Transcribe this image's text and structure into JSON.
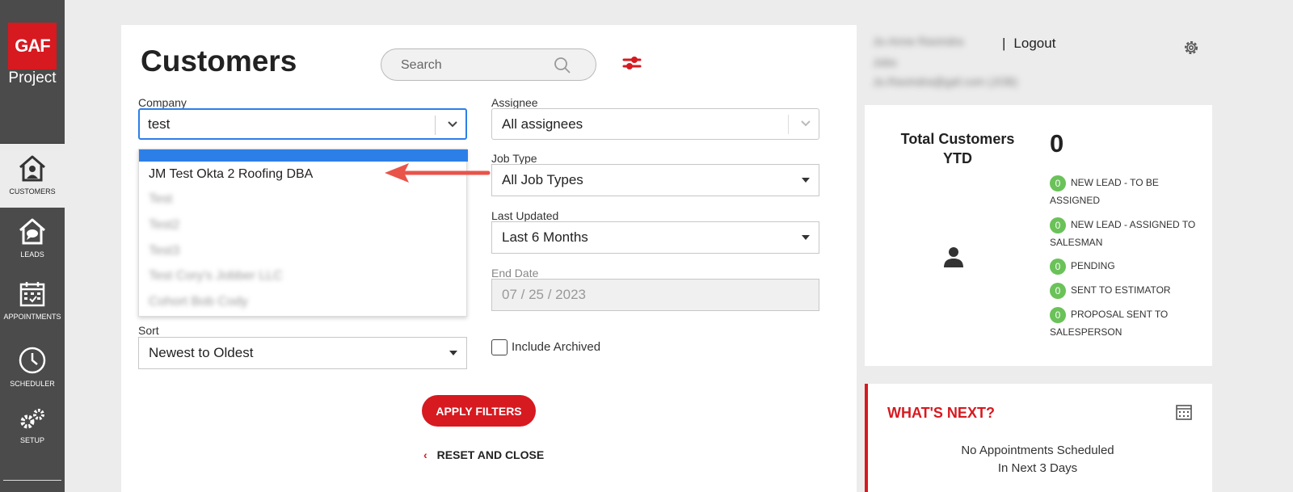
{
  "brand": {
    "logo": "GAF",
    "sub": "Project"
  },
  "nav": [
    {
      "label": "CUSTOMERS",
      "icon": "customers-icon"
    },
    {
      "label": "LEADS",
      "icon": "leads-icon"
    },
    {
      "label": "APPOINTMENTS",
      "icon": "appointments-icon"
    },
    {
      "label": "SCHEDULER",
      "icon": "scheduler-icon"
    },
    {
      "label": "SETUP",
      "icon": "setup-icon"
    }
  ],
  "page": {
    "title": "Customers"
  },
  "search": {
    "placeholder": "Search"
  },
  "filters": {
    "company": {
      "label": "Company",
      "value": "test"
    },
    "assignee": {
      "label": "Assignee",
      "value": "All assignees"
    },
    "job_type": {
      "label": "Job Type",
      "value": "All Job Types"
    },
    "last_updated": {
      "label": "Last Updated",
      "value": "Last 6 Months"
    },
    "end_date": {
      "label": "End Date",
      "value": "07 / 25 / 2023"
    },
    "sort": {
      "label": "Sort",
      "value": "Newest to Oldest"
    },
    "include_archived": {
      "label": "Include Archived",
      "checked": false
    }
  },
  "dropdown": {
    "options": [
      "JM Test Okta 2 Roofing DBA",
      "Test",
      "Test2",
      "Test3",
      "Test Cory's Jobber LLC",
      "Cohort Bob Cody"
    ]
  },
  "actions": {
    "apply": "APPLY FILTERS",
    "reset": "RESET AND CLOSE"
  },
  "user": {
    "name": "Jo-Anne Ravindra",
    "role": "Jobs",
    "email": "Jo.Ravindra@gaf.com (JOB)",
    "logout": "Logout"
  },
  "stats": {
    "title": "Total Customers YTD",
    "total": "0",
    "items": [
      {
        "count": "0",
        "label": "NEW LEAD - TO BE ASSIGNED"
      },
      {
        "count": "0",
        "label": "NEW LEAD - ASSIGNED TO SALESMAN"
      },
      {
        "count": "0",
        "label": "PENDING"
      },
      {
        "count": "0",
        "label": "SENT TO ESTIMATOR"
      },
      {
        "count": "0",
        "label": "PROPOSAL SENT TO SALESPERSON"
      }
    ]
  },
  "whats_next": {
    "title": "WHAT'S NEXT?",
    "message": "No Appointments Scheduled In Next 3 Days"
  },
  "colors": {
    "brand_red": "#d71920",
    "focus_blue": "#2d7fe8",
    "badge_green": "#6ac259",
    "sidebar": "#4b4b4b"
  }
}
